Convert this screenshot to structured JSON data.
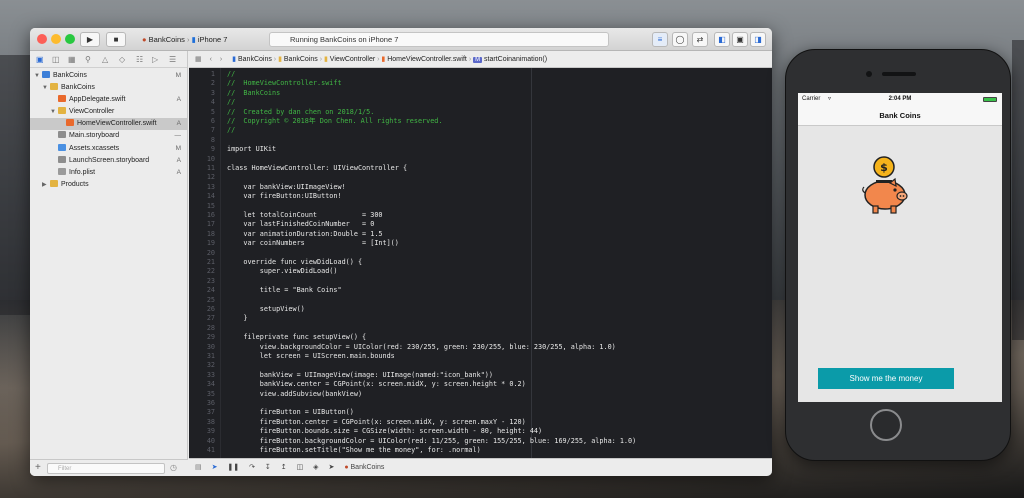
{
  "xcode": {
    "scheme": "BankCoins",
    "device": "iPhone 7",
    "status": "Running BankCoins on iPhone 7",
    "navigator_items": [
      {
        "label": "BankCoins",
        "badge": "M",
        "level": 0,
        "kind": "project",
        "open": true
      },
      {
        "label": "BankCoins",
        "badge": "",
        "level": 1,
        "kind": "folder",
        "open": true
      },
      {
        "label": "AppDelegate.swift",
        "badge": "A",
        "level": 2,
        "kind": "swift"
      },
      {
        "label": "ViewController",
        "badge": "",
        "level": 2,
        "kind": "folder",
        "open": true
      },
      {
        "label": "HomeViewController.swift",
        "badge": "A",
        "level": 3,
        "kind": "swift",
        "selected": true
      },
      {
        "label": "Main.storyboard",
        "badge": "—",
        "level": 2,
        "kind": "storyboard"
      },
      {
        "label": "Assets.xcassets",
        "badge": "M",
        "level": 2,
        "kind": "assets"
      },
      {
        "label": "LaunchScreen.storyboard",
        "badge": "A",
        "level": 2,
        "kind": "storyboard"
      },
      {
        "label": "Info.plist",
        "badge": "A",
        "level": 2,
        "kind": "plist"
      },
      {
        "label": "Products",
        "badge": "",
        "level": 1,
        "kind": "folder",
        "open": false
      }
    ],
    "filter_placeholder": "Filter",
    "breadcrumbs": [
      "BankCoins",
      "BankCoins",
      "ViewController",
      "HomeViewController.swift",
      "startCoinanimation()"
    ],
    "debug_target": "BankCoins",
    "code_lines": [
      {
        "n": "1",
        "t": "//"
      },
      {
        "n": "2",
        "t": "//  HomeViewController.swift"
      },
      {
        "n": "3",
        "t": "//  BankCoins"
      },
      {
        "n": "4",
        "t": "//"
      },
      {
        "n": "5",
        "t": "//  Created by dan chen on 2018/1/5."
      },
      {
        "n": "6",
        "t": "//  Copyright © 2018年 Don Chen. All rights reserved."
      },
      {
        "n": "7",
        "t": "//"
      },
      {
        "n": "8",
        "t": ""
      },
      {
        "n": "9",
        "t": "import UIKit"
      },
      {
        "n": "10",
        "t": ""
      },
      {
        "n": "11",
        "t": "class HomeViewController: UIViewController {"
      },
      {
        "n": "12",
        "t": ""
      },
      {
        "n": "13",
        "t": "    var bankView:UIImageView!"
      },
      {
        "n": "14",
        "t": "    var fireButton:UIButton!"
      },
      {
        "n": "15",
        "t": ""
      },
      {
        "n": "16",
        "t": "    let totalCoinCount           = 300"
      },
      {
        "n": "17",
        "t": "    var lastFinishedCoinNumber   = 0"
      },
      {
        "n": "18",
        "t": "    var animationDuration:Double = 1.5"
      },
      {
        "n": "19",
        "t": "    var coinNumbers              = [Int]()"
      },
      {
        "n": "20",
        "t": ""
      },
      {
        "n": "21",
        "t": "    override func viewDidLoad() {"
      },
      {
        "n": "22",
        "t": "        super.viewDidLoad()"
      },
      {
        "n": "23",
        "t": ""
      },
      {
        "n": "24",
        "t": "        title = \"Bank Coins\""
      },
      {
        "n": "25",
        "t": ""
      },
      {
        "n": "26",
        "t": "        setupView()"
      },
      {
        "n": "27",
        "t": "    }"
      },
      {
        "n": "28",
        "t": ""
      },
      {
        "n": "29",
        "t": "    fileprivate func setupView() {"
      },
      {
        "n": "30",
        "t": "        view.backgroundColor = UIColor(red: 230/255, green: 230/255, blue: 230/255, alpha: 1.0)"
      },
      {
        "n": "31",
        "t": "        let screen = UIScreen.main.bounds"
      },
      {
        "n": "32",
        "t": ""
      },
      {
        "n": "33",
        "t": "        bankView = UIImageView(image: UIImage(named:\"icon_bank\"))"
      },
      {
        "n": "34",
        "t": "        bankView.center = CGPoint(x: screen.midX, y: screen.height * 0.2)"
      },
      {
        "n": "35",
        "t": "        view.addSubview(bankView)"
      },
      {
        "n": "36",
        "t": ""
      },
      {
        "n": "37",
        "t": "        fireButton = UIButton()"
      },
      {
        "n": "38",
        "t": "        fireButton.center = CGPoint(x: screen.midX, y: screen.maxY - 120)"
      },
      {
        "n": "39",
        "t": "        fireButton.bounds.size = CGSize(width: screen.width - 80, height: 44)"
      },
      {
        "n": "40",
        "t": "        fireButton.backgroundColor = UIColor(red: 11/255, green: 155/255, blue: 169/255, alpha: 1.0)"
      },
      {
        "n": "41",
        "t": "        fireButton.setTitle(\"Show me the money\", for: .normal)"
      }
    ]
  },
  "simulator": {
    "carrier": "Carrier",
    "time": "2:04 PM",
    "nav_title": "Bank Coins",
    "button_label": "Show me the money"
  },
  "colors": {
    "accent": "#0b9ba9",
    "pig": "#f2874c",
    "coin": "#f5b31b",
    "editor_bg": "#1f2024"
  }
}
